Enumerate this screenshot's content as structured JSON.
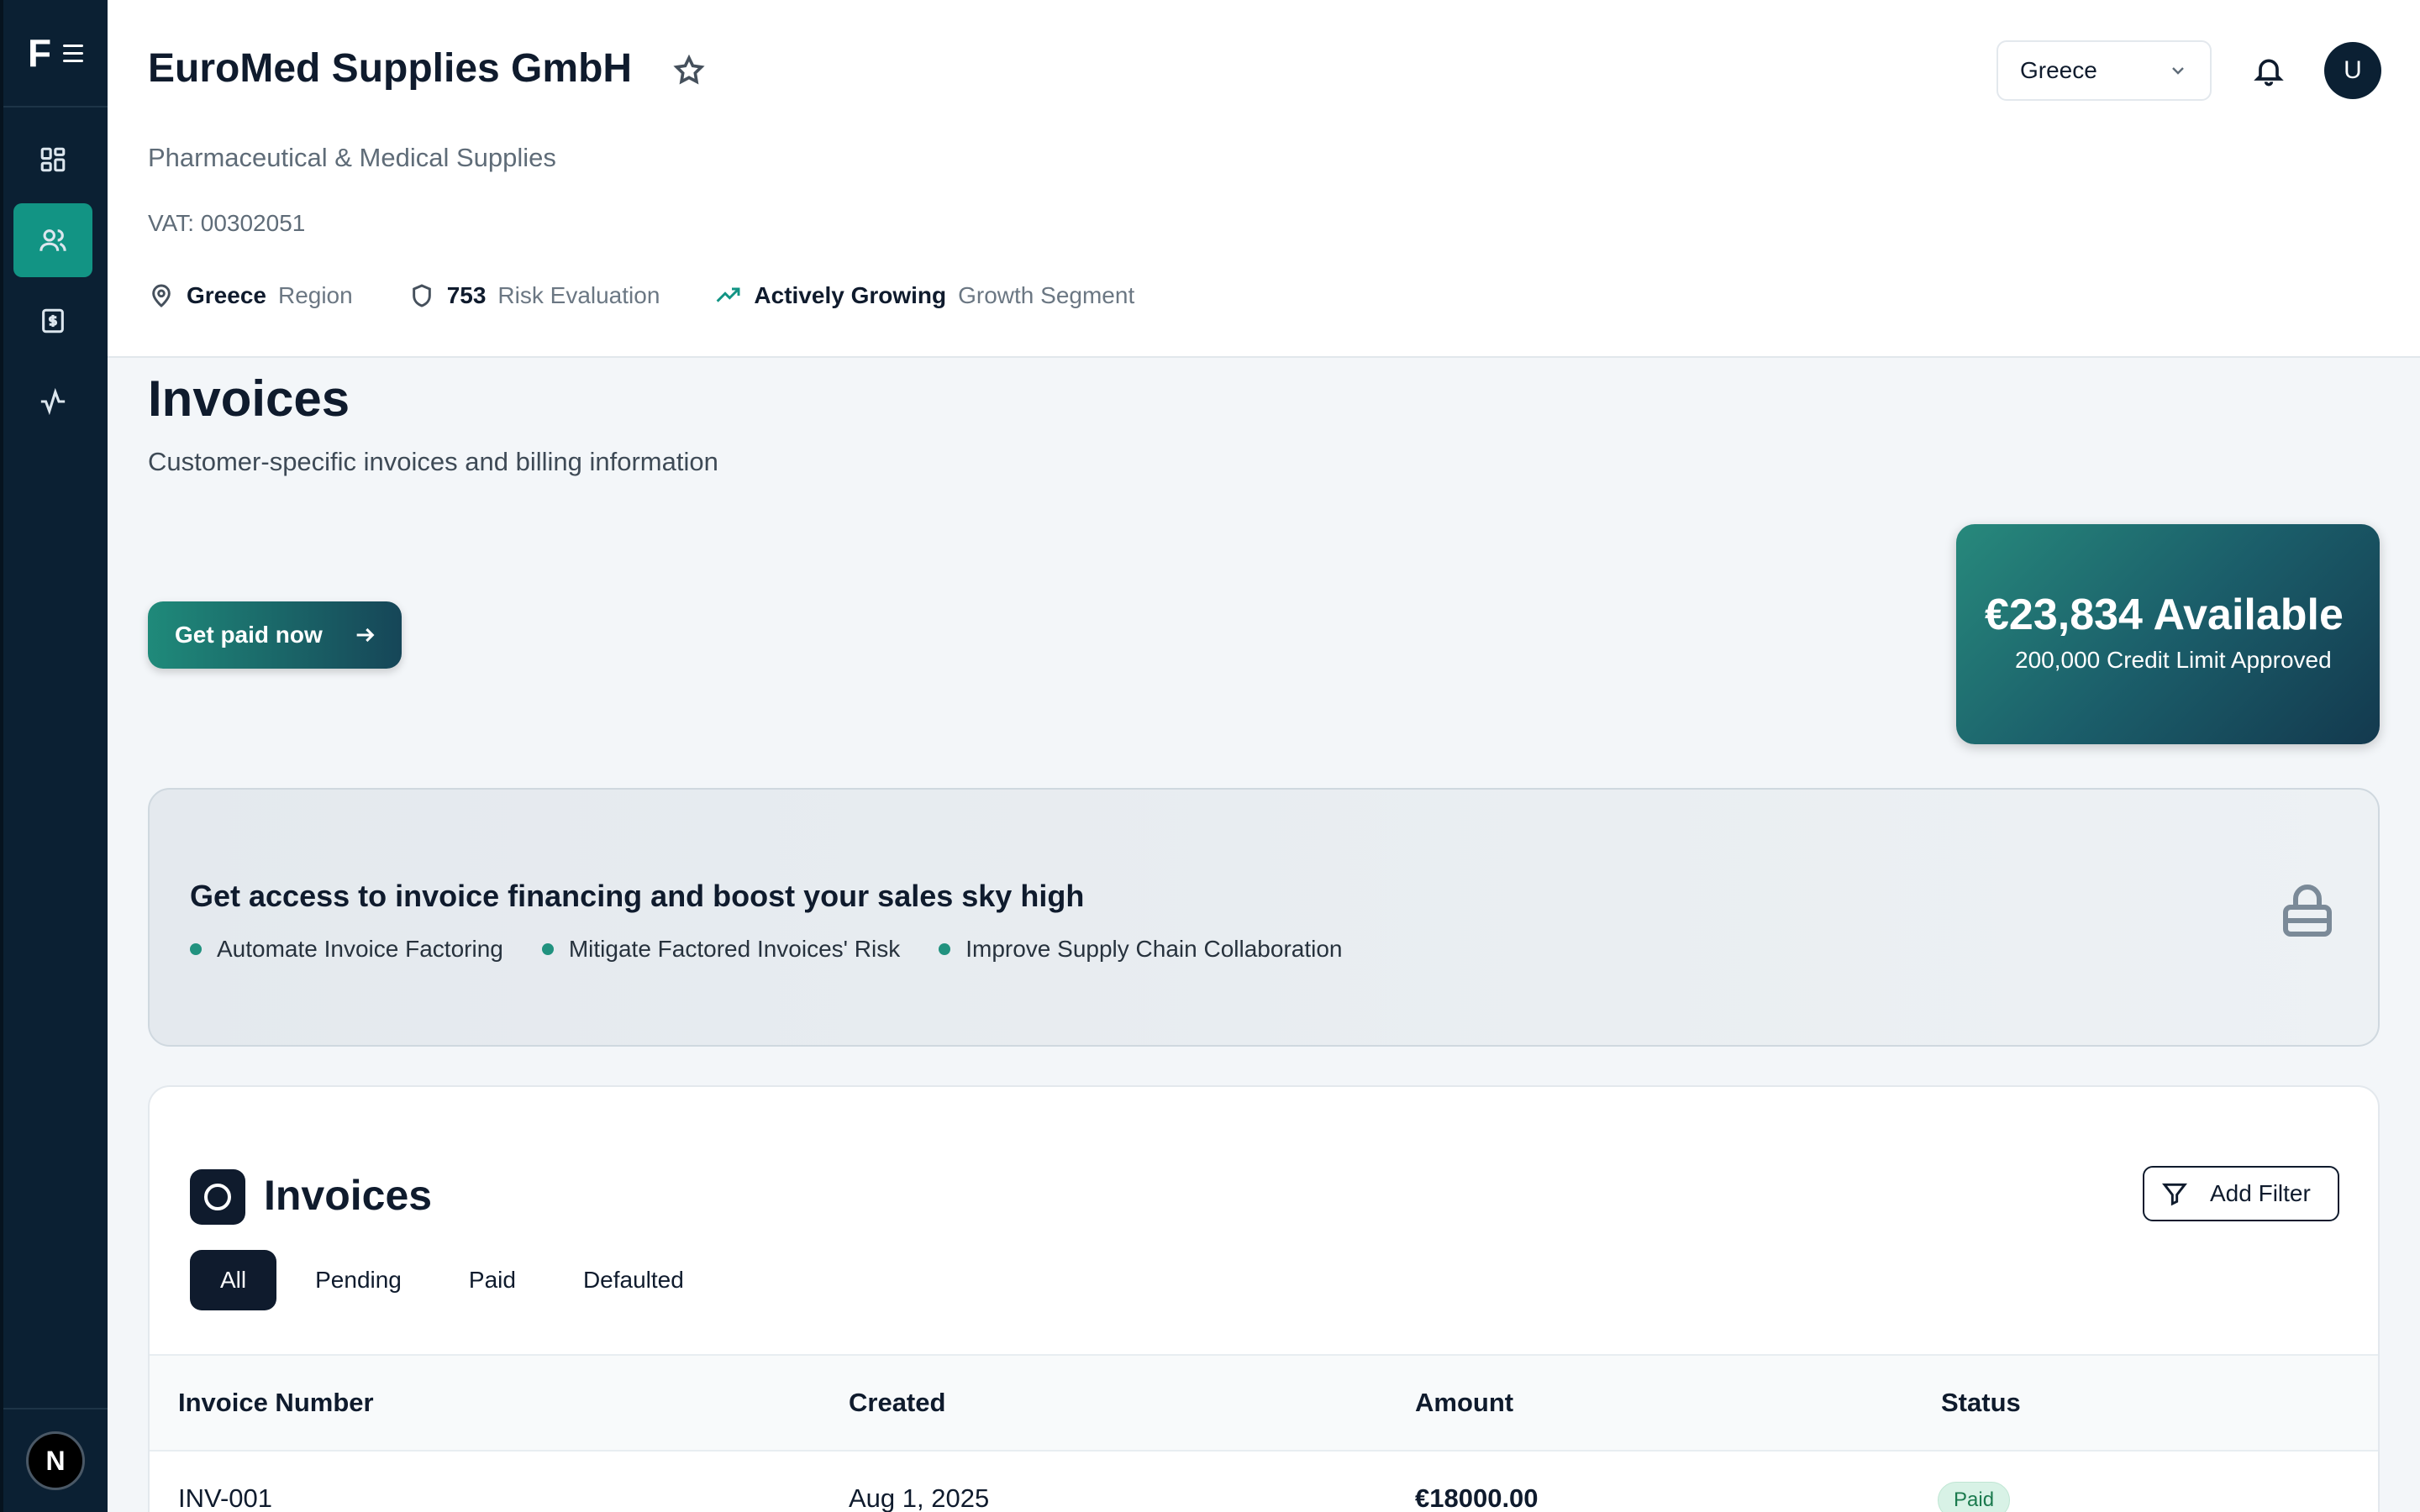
{
  "sidebar": {
    "logo": "F",
    "items": [
      {
        "name": "dashboard-icon",
        "active": false
      },
      {
        "name": "users-icon",
        "active": true
      },
      {
        "name": "invoice-dollar-icon",
        "active": false
      },
      {
        "name": "activity-icon",
        "active": false
      }
    ],
    "bottom_avatar": "N"
  },
  "header": {
    "company_name": "EuroMed Supplies GmbH",
    "industry": "Pharmaceutical & Medical Supplies",
    "vat": "VAT: 00302051",
    "meta": {
      "region_value": "Greece",
      "region_label": "Region",
      "risk_value": "753",
      "risk_label": "Risk Evaluation",
      "growth_value": "Actively Growing",
      "growth_label": "Growth Segment"
    },
    "country_select": "Greece",
    "user_avatar": "U"
  },
  "invoices_section": {
    "title": "Invoices",
    "subtitle": "Customer-specific invoices and billing information",
    "get_paid_label": "Get paid now",
    "credit": {
      "available": "€23,834 Available",
      "limit": "200,000 Credit Limit Approved"
    },
    "promo": {
      "title": "Get access to invoice financing and boost your sales sky high",
      "points": [
        "Automate Invoice Factoring",
        "Mitigate Factored Invoices' Risk",
        "Improve Supply Chain Collaboration"
      ]
    }
  },
  "invoices_table": {
    "title": "Invoices",
    "add_filter_label": "Add Filter",
    "tabs": [
      "All",
      "Pending",
      "Paid",
      "Defaulted"
    ],
    "active_tab": "All",
    "columns": [
      "Invoice Number",
      "Created",
      "Amount",
      "Status"
    ],
    "rows": [
      {
        "number": "INV-001",
        "created": "Aug 1, 2025",
        "amount": "€18000.00",
        "status": "Paid"
      }
    ]
  },
  "colors": {
    "sidebar_bg": "#0b2033",
    "accent": "#129484",
    "paid_badge_bg": "#d8f2e6"
  }
}
